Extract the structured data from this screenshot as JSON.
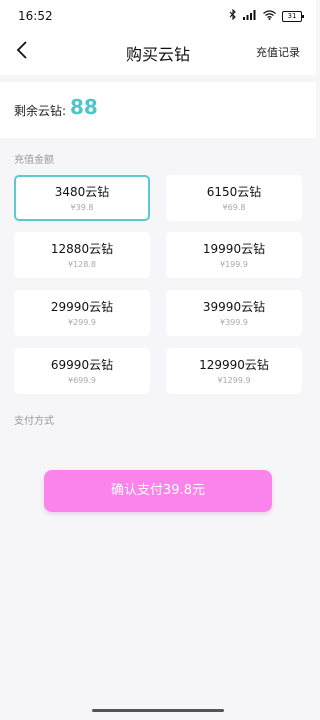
{
  "status_bar": {
    "time": "16:52",
    "icons": [
      "bluetooth-icon",
      "signal-icon",
      "wifi-icon"
    ],
    "battery": "31"
  },
  "header": {
    "title": "购买云钻",
    "right_link": "充值记录",
    "back_icon": "chevron-left-icon"
  },
  "balance": {
    "label": "剩余云钻:",
    "value": "88",
    "value_color": "#4fc4c9"
  },
  "recharge_section_label": "充值金额",
  "options": [
    {
      "amount": "3480云钻",
      "price": "¥39.8",
      "selected": true
    },
    {
      "amount": "6150云钻",
      "price": "¥69.8",
      "selected": false
    },
    {
      "amount": "12880云钻",
      "price": "¥128.8",
      "selected": false
    },
    {
      "amount": "19990云钻",
      "price": "¥199.9",
      "selected": false
    },
    {
      "amount": "29990云钻",
      "price": "¥299.9",
      "selected": false
    },
    {
      "amount": "39990云钻",
      "price": "¥399.9",
      "selected": false
    },
    {
      "amount": "69990云钻",
      "price": "¥699.9",
      "selected": false
    },
    {
      "amount": "129990云钻",
      "price": "¥1299.9",
      "selected": false
    }
  ],
  "payment_section_label": "支付方式",
  "pay_button": {
    "label": "确认支付39.8元",
    "color": "#fb84ec"
  }
}
